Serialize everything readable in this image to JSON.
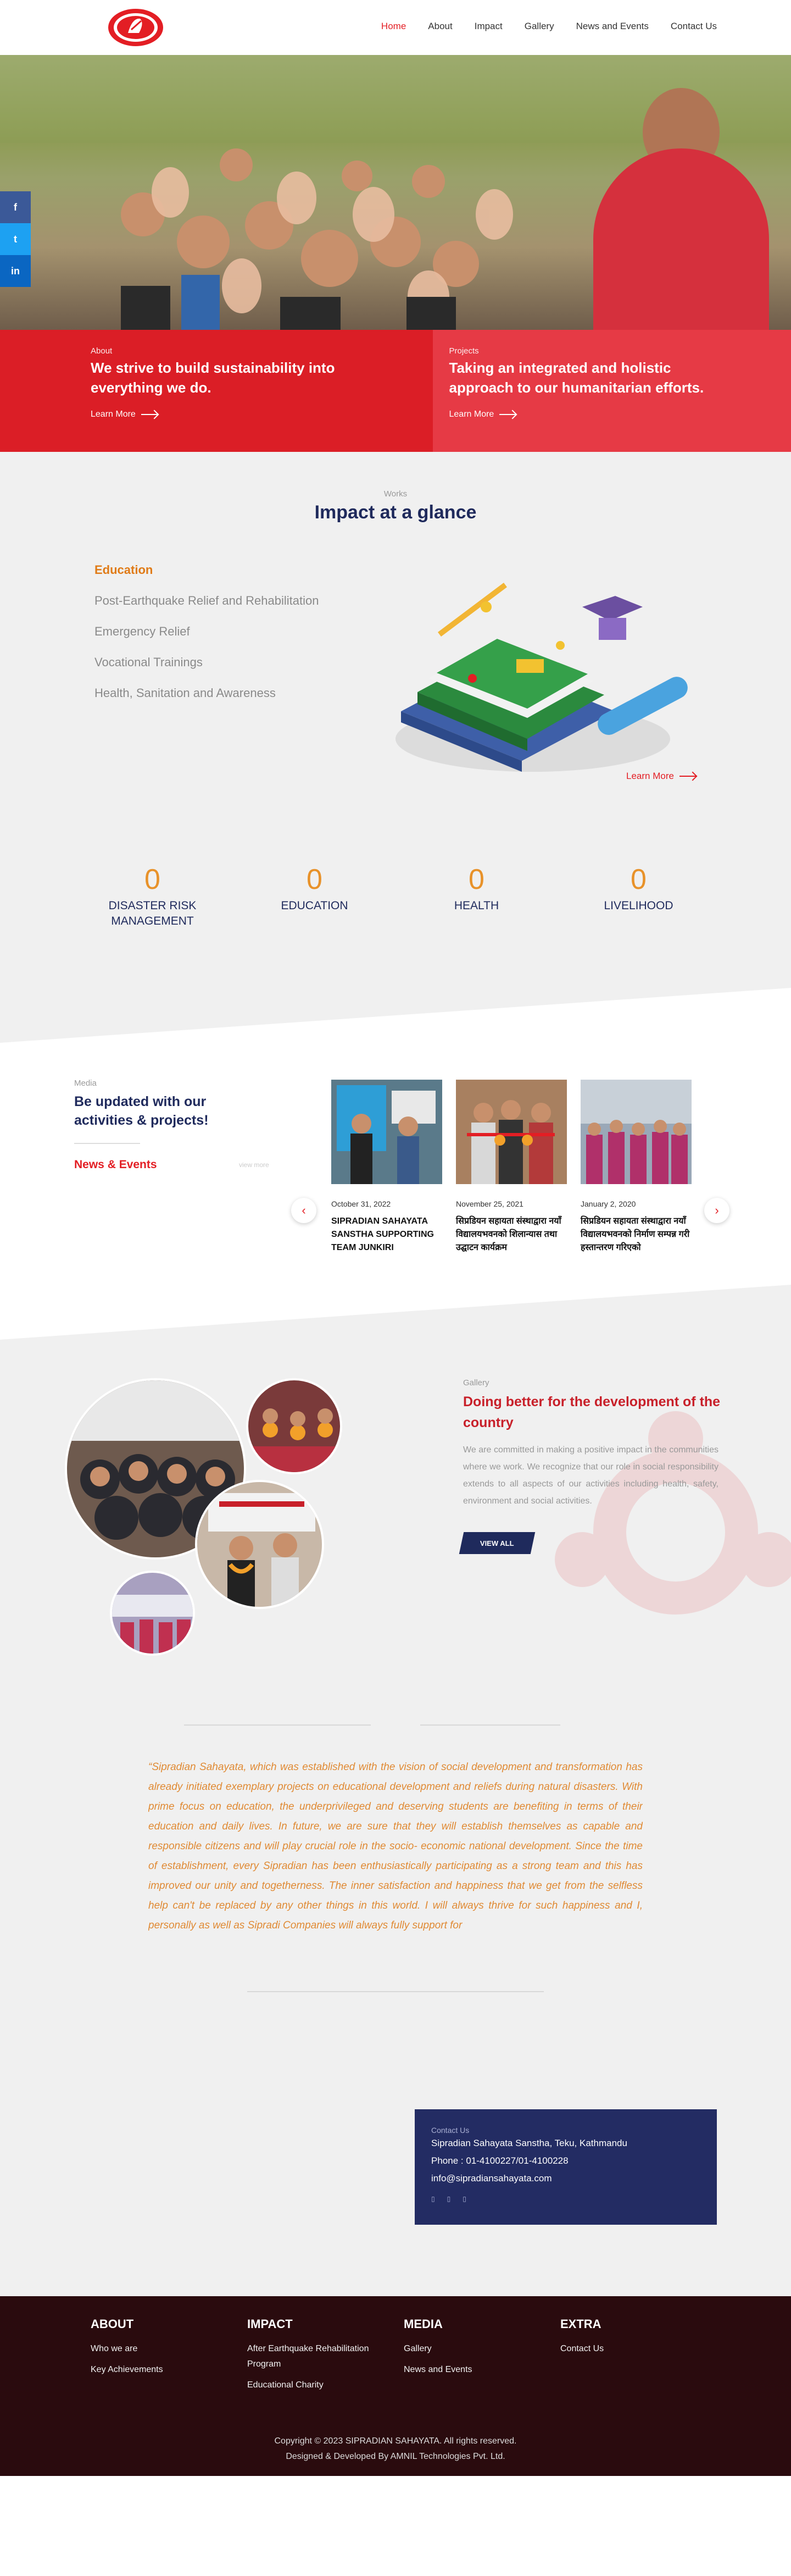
{
  "nav": {
    "items": [
      "Home",
      "About",
      "Impact",
      "Gallery",
      "News and Events",
      "Contact Us"
    ]
  },
  "cards": [
    {
      "label": "About",
      "title": "We strive to build sustainability into everything we do.",
      "more": "Learn More"
    },
    {
      "label": "Projects",
      "title": "Taking an integrated and holistic approach to our humanitarian efforts.",
      "more": "Learn More"
    }
  ],
  "impact": {
    "label": "Works",
    "title": "Impact at a glance",
    "items": [
      "Education",
      "Post-Earthquake Relief and Rehabilitation",
      "Emergency Relief",
      "Vocational Trainings",
      "Health, Sanitation and Awareness"
    ],
    "more": "Learn More",
    "stats": [
      {
        "value": "0",
        "caption": "DISASTER RISK MANAGEMENT"
      },
      {
        "value": "0",
        "caption": "EDUCATION"
      },
      {
        "value": "0",
        "caption": "HEALTH"
      },
      {
        "value": "0",
        "caption": "LIVELIHOOD"
      }
    ]
  },
  "media": {
    "label": "Media",
    "title": "Be updated with our activities & projects!",
    "news": "News & Events",
    "viewmore": "view more",
    "cards": [
      {
        "date": "October 31, 2022",
        "title": "SIPRADIAN SAHAYATA SANSTHA SUPPORTING TEAM JUNKIRI"
      },
      {
        "date": "November 25, 2021",
        "title": "सिप्रडियन सहायता संस्थाद्वारा नयाँ विद्यालयभवनको शिलान्यास तथा उद्घाटन कार्यक्रम"
      },
      {
        "date": "January 2, 2020",
        "title": "सिप्रडियन सहायता संस्थाद्वारा नयाँ विद्यालयभवनको निर्माण सम्पन्न गरी हस्तान्तरण गरिएको"
      }
    ]
  },
  "gallery": {
    "label": "Gallery",
    "title": "Doing better for the development of the country",
    "text": "We are committed in making a positive impact in the communities where we work. We recognize that our role in social responsibility extends to all aspects of our activities including health, safety, environment and social activities.",
    "button": "VIEW ALL"
  },
  "quote": {
    "text": "“Sipradian Sahayata, which was established with the vision of social development and transformation has already initiated exemplary projects on educational development and reliefs during natural disasters. With prime focus on education, the underprivileged and deserving students are benefiting in terms of their education and daily lives. In future, we are sure that they will establish themselves as capable and responsible citizens and will play crucial role in the socio- economic national development. Since the time of establishment, every Sipradian has been enthusiastically participating as a strong team and this has improved our unity and togetherness. The inner satisfaction and happiness that we get from the selfless help can't be replaced by any other things in this world. I will always thrive for such happiness and I, personally as well as Sipradi Companies will always fully support for"
  },
  "contact": {
    "label": "Contact Us",
    "address": "Sipradian Sahayata Sanstha, Teku, Kathmandu",
    "phone": "Phone : 01-4100227/01-4100228",
    "email": "info@sipradiansahayata.com"
  },
  "footer": {
    "columns": [
      {
        "heading": "ABOUT",
        "items": [
          "Who we are",
          "Key Achievements"
        ]
      },
      {
        "heading": "IMPACT",
        "items": [
          "After Earthquake Rehabilitation Program",
          "Educational Charity"
        ]
      },
      {
        "heading": "MEDIA",
        "items": [
          "Gallery",
          "News and Events"
        ]
      },
      {
        "heading": "EXTRA",
        "items": [
          "Contact Us"
        ]
      }
    ],
    "copyright": "Copyright © 2023 SIPRADIAN SAHAYATA. All rights reserved.",
    "developer": "Designed & Developed By AMNIL Technologies Pvt. Ltd."
  },
  "colors": {
    "brand_red": "#e31e24",
    "navy": "#1f2a5c",
    "orange": "#e07b17",
    "footer_bg": "#2a0b0e"
  },
  "icons": [
    "logo",
    "facebook-icon",
    "twitter-icon",
    "linkedin-icon",
    "arrow-right-icon",
    "chevron-left-icon",
    "chevron-right-icon"
  ]
}
